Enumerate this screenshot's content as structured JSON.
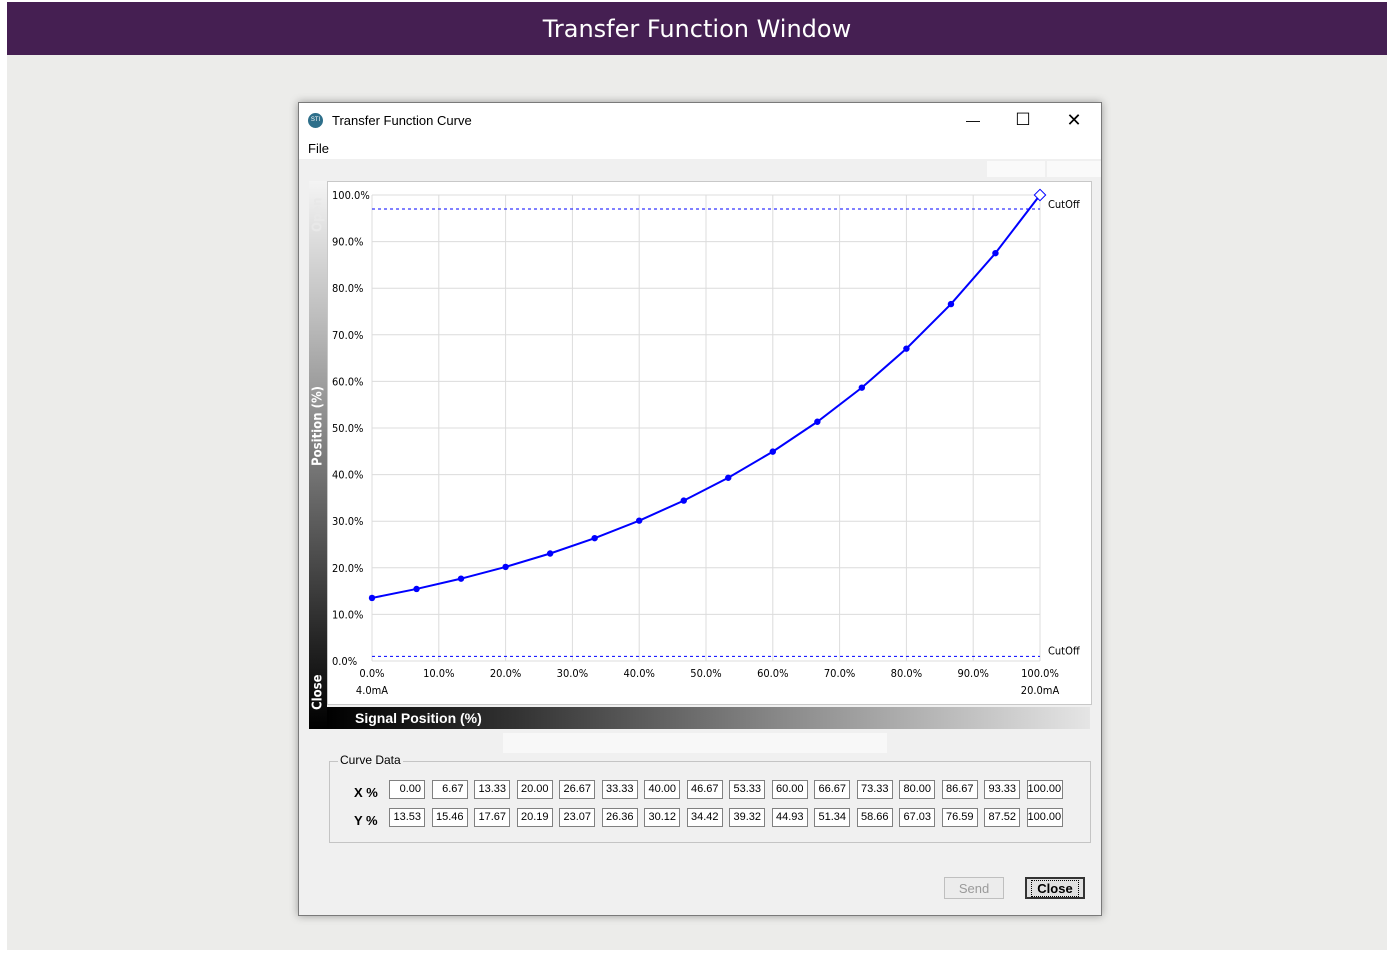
{
  "page": {
    "banner_title": "Transfer Function Window"
  },
  "window": {
    "title": "Transfer Function Curve",
    "app_icon": "STI",
    "controls": {
      "minimize": "—",
      "maximize": "☐",
      "close": "✕"
    },
    "menu": [
      "File"
    ]
  },
  "chart_data": {
    "type": "line",
    "ylabel": "Position (%)",
    "xlabel": "Signal Position (%)",
    "ylabel_top": "Open",
    "ylabel_bottom": "Close",
    "xlim": [
      0,
      100
    ],
    "ylim": [
      0,
      100
    ],
    "x_ticks": [
      "0.0%",
      "10.0%",
      "20.0%",
      "30.0%",
      "40.0%",
      "50.0%",
      "60.0%",
      "70.0%",
      "80.0%",
      "90.0%",
      "100.0%"
    ],
    "y_ticks": [
      "0.0%",
      "10.0%",
      "20.0%",
      "30.0%",
      "40.0%",
      "50.0%",
      "60.0%",
      "70.0%",
      "80.0%",
      "90.0%",
      "100.0%"
    ],
    "x_sublabels": {
      "left": "4.0mA",
      "right": "20.0mA"
    },
    "cutoff_labels": {
      "upper": "CutOff",
      "lower": "CutOff"
    },
    "cutoff_levels": [
      97,
      1
    ],
    "grid": true,
    "series": [
      {
        "x": [
          0.0,
          6.67,
          13.33,
          20.0,
          26.67,
          33.33,
          40.0,
          46.67,
          53.33,
          60.0,
          66.67,
          73.33,
          80.0,
          86.67,
          93.33,
          100.0
        ],
        "y": [
          13.53,
          15.46,
          17.67,
          20.19,
          23.07,
          26.36,
          30.12,
          34.42,
          39.32,
          44.93,
          51.34,
          58.66,
          67.03,
          76.59,
          87.52,
          100.0
        ],
        "color": "#0000ff"
      }
    ]
  },
  "curve_data": {
    "legend": "Curve Data",
    "x_label": "X %",
    "y_label": "Y %",
    "x_values": [
      "0.00",
      "6.67",
      "13.33",
      "20.00",
      "26.67",
      "33.33",
      "40.00",
      "46.67",
      "53.33",
      "60.00",
      "66.67",
      "73.33",
      "80.00",
      "86.67",
      "93.33",
      "100.00"
    ],
    "y_values": [
      "13.53",
      "15.46",
      "17.67",
      "20.19",
      "23.07",
      "26.36",
      "30.12",
      "34.42",
      "39.32",
      "44.93",
      "51.34",
      "58.66",
      "67.03",
      "76.59",
      "87.52",
      "100.00"
    ]
  },
  "buttons": {
    "send": "Send",
    "close": "Close"
  },
  "colors": {
    "banner": "#451f52",
    "curve": "#0000ff",
    "cutoff_line": "#0000ff"
  }
}
